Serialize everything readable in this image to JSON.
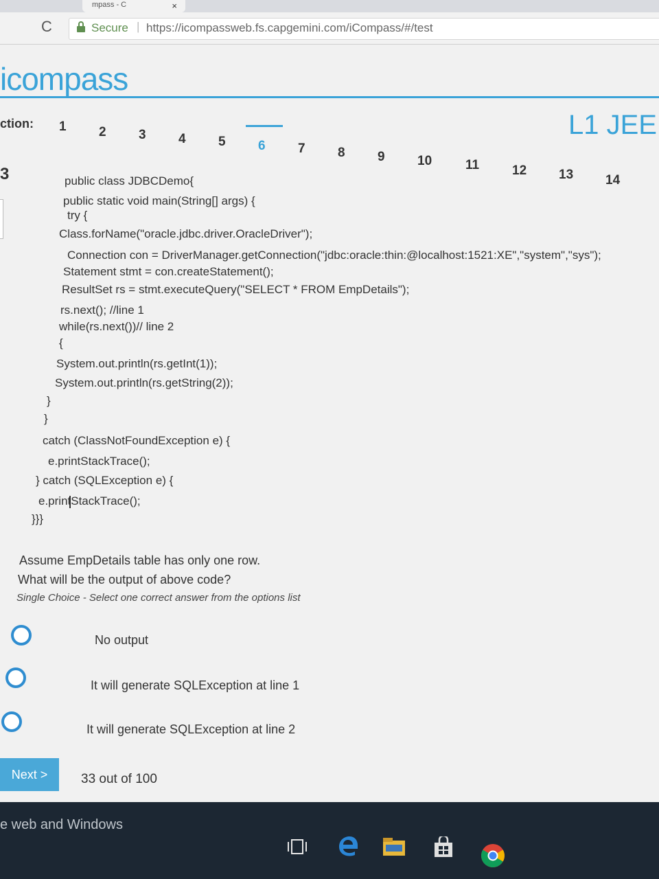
{
  "browser": {
    "tab_title": "mpass - C",
    "tab_close": "×",
    "reload": "C",
    "secure_label": "Secure",
    "url": "https://icompassweb.fs.capgemini.com/iCompass/#/test"
  },
  "header": {
    "logo": "icompass",
    "section_label": "ction:",
    "course": "L1 JEE",
    "question_numbers": [
      "1",
      "2",
      "3",
      "4",
      "5",
      "6",
      "7",
      "8",
      "9",
      "10",
      "11",
      "12",
      "13",
      "14"
    ],
    "active_number": "6"
  },
  "question": {
    "index": "3",
    "code_lines": [
      "public class JDBCDemo{",
      "public static void main(String[] args) {",
      "try {",
      "Class.forName(\"oracle.jdbc.driver.OracleDriver\");",
      "Connection con = DriverManager.getConnection(\"jdbc:oracle:thin:@localhost:1521:XE\",\"system\",\"sys\");",
      "Statement stmt = con.createStatement();",
      "ResultSet rs = stmt.executeQuery(\"SELECT * FROM EmpDetails\");",
      "rs.next(); //line 1",
      "while(rs.next())// line 2",
      "{",
      "System.out.println(rs.getInt(1));",
      "System.out.println(rs.getString(2));",
      "}",
      "}",
      "catch (ClassNotFoundException e) {",
      "e.printStackTrace();",
      "} catch (SQLException e) {",
      "e.printStackTrace();",
      "}}}"
    ],
    "text_line1": "Assume EmpDetails table has only one row.",
    "text_line2": "What will be the output of above code?",
    "hint": "Single Choice - Select one correct answer from the options list",
    "options": [
      "No output",
      "It will generate SQLException at line 1",
      "It will generate SQLException at line 2"
    ]
  },
  "footer": {
    "next_label": "Next >",
    "progress": "33 out of 100"
  },
  "taskbar": {
    "search_text": "e web and Windows",
    "icons": [
      "task-view-icon",
      "edge-icon",
      "file-explorer-icon",
      "store-icon",
      "chrome-icon"
    ]
  },
  "colors": {
    "accent": "#3aa3d8",
    "radio": "#2f8dd0",
    "taskbar": "#1c2733"
  }
}
